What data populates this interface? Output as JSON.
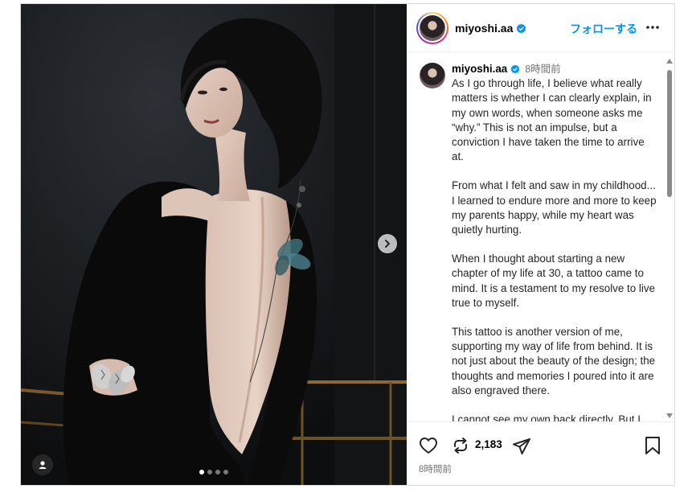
{
  "post": {
    "username": "miyoshi.aa",
    "verified": true,
    "follow_label": "フォローする",
    "more_icon": "more-horizontal-icon"
  },
  "caption": {
    "username": "miyoshi.aa",
    "time": "8時間前",
    "paragraphs": [
      "As I go through life, I believe what really matters is whether I can clearly explain, in my own words, when someone asks me “why.”  This is not an impulse, but a conviction I have taken the time to arrive at.",
      "From what I felt and saw in my childhood... I learned to endure more and more to keep my parents happy, while my heart was quietly hurting.",
      "When I thought about starting a new chapter of my life at 30, a tattoo came to mind. It is a testament to my resolve to live true to myself.",
      "This tattoo is another version of me, supporting my way of life from behind. It is not just about the beauty of the design; the thoughts and memories I poured into it are also engraved there.",
      "I cannot see my own back directly. But I"
    ]
  },
  "carousel": {
    "total": 4,
    "current": 1,
    "next_icon": "chevron-right-icon",
    "tag_icon": "user-tag-icon"
  },
  "actions": {
    "repost_count": "2,183",
    "timestamp": "8時間前",
    "icons": [
      "heart-icon",
      "repost-icon",
      "share-icon",
      "bookmark-icon"
    ]
  },
  "colors": {
    "accent": "#0095f6",
    "verified": "#0095f6",
    "muted": "#737373",
    "photo_bg": "#16181b"
  }
}
